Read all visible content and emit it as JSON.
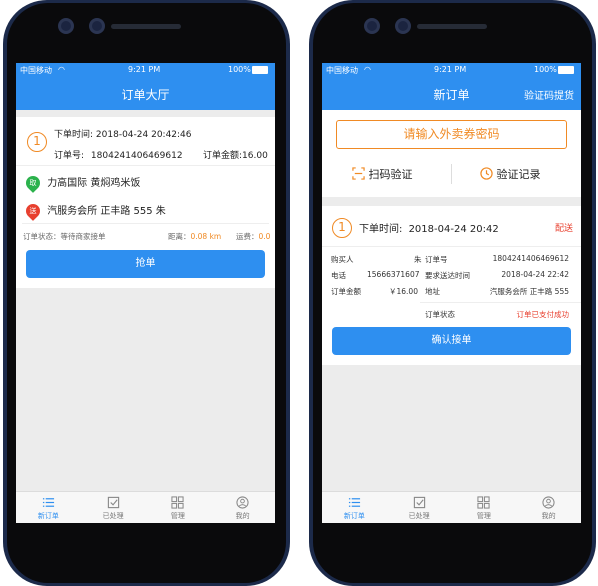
{
  "status": {
    "carrier": "中国移动",
    "time": "9:21 PM",
    "battery": "100%"
  },
  "left": {
    "nav_title": "订单大厅",
    "order": {
      "index": "1",
      "time_label": "下单时间:",
      "time_value": "2018-04-24 20:42:46",
      "no_label": "订单号:",
      "no_value": "1804241406469612",
      "amount_label": "订单金额:",
      "amount_value": "16.00",
      "pickup_tag": "取",
      "pickup": "力高国际 黄焖鸡米饭",
      "delivery_tag": "送",
      "delivery": "汽服务会所 正丰路 555 朱",
      "state_label": "订单状态：",
      "state_value": "等待商家接单",
      "distance_label": "距离：",
      "distance_value": "0.08 km",
      "fee_label": "运费：",
      "fee_value": "0.0",
      "grab_button": "抢单"
    }
  },
  "right": {
    "nav_title": "新订单",
    "nav_right": "验证码提货",
    "coupon_button": "请输入外卖券密码",
    "scan_label": "扫码验证",
    "record_label": "验证记录",
    "order": {
      "index": "1",
      "time_label": "下单时间:",
      "time_value": "2018-04-24 20:42",
      "type": "配送",
      "buyer_label": "购买人",
      "buyer_value": "朱",
      "no_label": "订单号",
      "no_value": "1804241406469612",
      "phone_label": "电话",
      "phone_value": "15666371607",
      "req_time_label": "要求送达时间",
      "req_time_value": "2018-04-24 22:42",
      "amount_label": "订单金额",
      "amount_value": "￥16.00",
      "addr_label": "地址",
      "addr_value": "汽服务会所 正丰路 555",
      "state_label": "订单状态",
      "state_value": "订单已支付成功",
      "confirm_button": "确认接单"
    }
  },
  "tabbar": [
    "新订单",
    "已处理",
    "管理",
    "我的"
  ],
  "icons": {
    "tab_new": "list-icon",
    "tab_done": "checkbox-icon",
    "tab_manage": "grid-icon",
    "tab_mine": "user-icon",
    "scan": "scan-icon",
    "record": "clock-icon",
    "wifi": "wifi-icon",
    "battery": "battery-icon"
  },
  "colors": {
    "primary": "#2e8ff0",
    "accent": "#f08a24",
    "danger": "#e8402f",
    "pickup_pin": "#2bb24c",
    "delivery_pin": "#e8402f"
  }
}
